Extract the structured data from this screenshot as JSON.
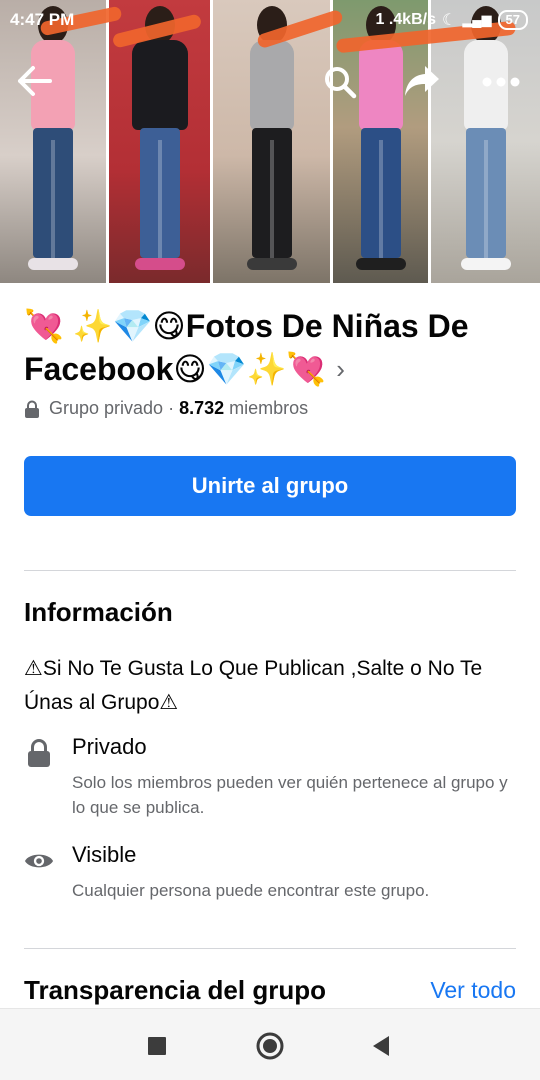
{
  "status_bar": {
    "time": "4:47 PM",
    "speed": "1 .4kB/s",
    "battery": "57"
  },
  "cover": {
    "icons": [
      "back-arrow-icon",
      "search-icon",
      "share-icon",
      "more-dots-icon"
    ]
  },
  "group": {
    "title": "💘 ✨💎😋Fotos De Niñas De Facebook😋💎✨💘",
    "privacy": "Grupo privado",
    "separator": "·",
    "member_count": "8.732",
    "members_label": "miembros",
    "join_label": "Unirte al grupo"
  },
  "about": {
    "heading": "Información",
    "description": "⚠Si No Te Gusta Lo Que Publican ,Salte o No Te Únas al Grupo⚠",
    "private_title": "Privado",
    "private_desc": "Solo los miembros pueden ver quién pertenece al grupo y lo que se publica.",
    "visible_title": "Visible",
    "visible_desc": "Cualquier persona puede encontrar este grupo."
  },
  "transparency": {
    "heading": "Transparencia del grupo",
    "see_all": "Ver todo"
  },
  "colors": {
    "accent": "#1877f2",
    "secondary_text": "#65676b",
    "scribble": "#f0652c"
  }
}
